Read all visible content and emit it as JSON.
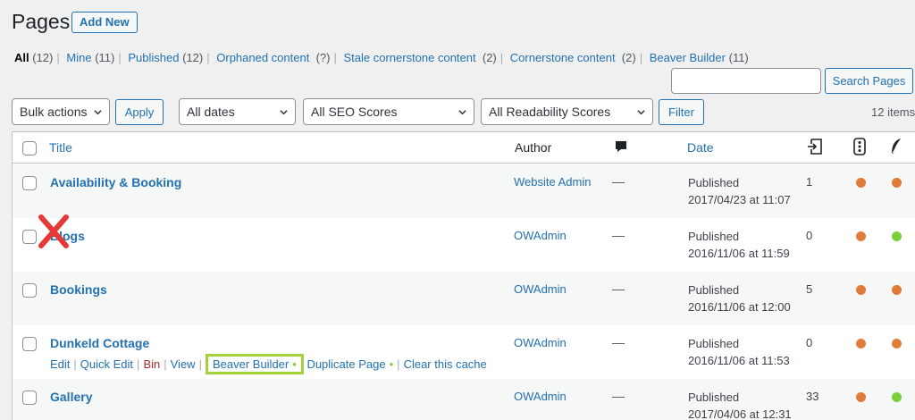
{
  "header": {
    "title": "Pages",
    "add_new": "Add New"
  },
  "views": [
    {
      "label": "All",
      "count": "(12)",
      "current": true
    },
    {
      "label": "Mine",
      "count": "(11)"
    },
    {
      "label": "Published",
      "count": "(12)"
    },
    {
      "label": "Orphaned content",
      "count": "(?)"
    },
    {
      "label": "Stale cornerstone content",
      "count": "(2)"
    },
    {
      "label": "Cornerstone content",
      "count": "(2)"
    },
    {
      "label": "Beaver Builder",
      "count": "(11)"
    }
  ],
  "search": {
    "button": "Search Pages",
    "value": ""
  },
  "filters": {
    "bulk_actions": "Bulk actions",
    "apply": "Apply",
    "dates": "All dates",
    "seo": "All SEO Scores",
    "readability": "All Readability Scores",
    "filter": "Filter",
    "items_count": "12 items"
  },
  "table": {
    "headers": {
      "title": "Title",
      "author": "Author",
      "date": "Date"
    },
    "header_icons": [
      "comment-icon",
      "incoming-links-icon",
      "seo-traffic-light-icon",
      "readability-feather-icon"
    ],
    "rows": [
      {
        "title": "Availability & Booking",
        "author": "Website Admin",
        "comments": "—",
        "status": "Published",
        "date": "2017/04/23 at 11:07",
        "links": "1",
        "seo": "#e07b39",
        "readability": "#e07b39"
      },
      {
        "title": "Blogs",
        "author": "OWAdmin",
        "comments": "—",
        "status": "Published",
        "date": "2016/11/06 at 11:59",
        "links": "0",
        "seo": "#e07b39",
        "readability": "#7ad03a"
      },
      {
        "title": "Bookings",
        "author": "OWAdmin",
        "comments": "—",
        "status": "Published",
        "date": "2016/11/06 at 12:00",
        "links": "5",
        "seo": "#e07b39",
        "readability": "#e07b39"
      },
      {
        "title": "Dunkeld Cottage",
        "author": "OWAdmin",
        "comments": "—",
        "status": "Published",
        "date": "2016/11/06 at 11:53",
        "links": "0",
        "seo": "#e07b39",
        "readability": "#e07b39"
      },
      {
        "title": "Gallery",
        "author": "OWAdmin",
        "comments": "—",
        "status": "Published",
        "date": "2017/04/06 at 12:31",
        "links": "33",
        "seo": "#e07b39",
        "readability": "#7ad03a"
      }
    ],
    "row_actions": {
      "edit": "Edit",
      "quick_edit": "Quick Edit",
      "bin": "Bin",
      "view": "View",
      "beaver_builder": "Beaver Builder",
      "duplicate_page": "Duplicate Page",
      "clear_cache": "Clear this cache"
    }
  },
  "annotations": {
    "highlight_color": "#a3d13c",
    "cross_color": "#e53935"
  }
}
